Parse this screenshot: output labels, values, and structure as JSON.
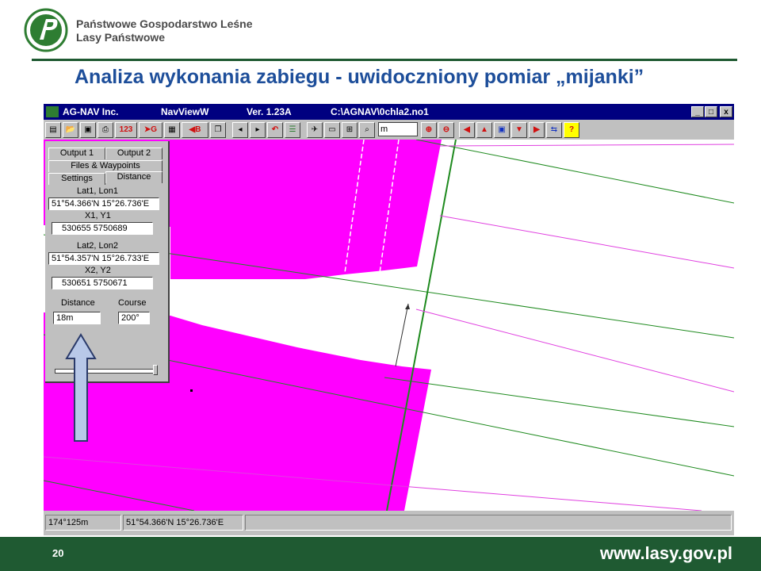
{
  "header": {
    "org_line1": "Państwowe Gospodarstwo Leśne",
    "org_line2": "Lasy Państwowe",
    "slide_title": "Analiza wykonania zabiegu - uwidoczniony pomiar „mijanki”"
  },
  "window": {
    "vendor": "AG-NAV Inc.",
    "app": "NavViewW",
    "version": "Ver. 1.23A",
    "file_path": "C:\\AGNAV\\0chla2.no1",
    "title_bar_color": "#000080",
    "buttons": {
      "minimize": "_",
      "maximize": "□",
      "close": "x"
    }
  },
  "toolbar": {
    "units_value": "m",
    "gps_label": "123",
    "g_label": "G",
    "b_label": "B",
    "help_label": "?",
    "icons": [
      "print-icon",
      "open-icon",
      "save-icon",
      "printer-icon",
      "gps-icon",
      "go-icon",
      "grid-icon",
      "back-icon",
      "copy-icon",
      "prev-icon",
      "next-icon",
      "undo-icon",
      "list-icon",
      "plane-icon",
      "map-icon",
      "zoom-box-icon",
      "zoom-in-icon",
      "zoom-out-icon",
      "arrow-left-icon",
      "arrow-up-icon",
      "center-icon",
      "arrow-down-icon",
      "arrow-right-icon",
      "swap-icon",
      "help-icon"
    ]
  },
  "panel": {
    "tabs": {
      "output1": "Output 1",
      "output2": "Output 2",
      "files": "Files & Waypoints",
      "settings": "Settings",
      "distance": "Distance"
    },
    "lat1_label": "Lat1, Lon1",
    "lat1_value": "51°54.366'N 15°26.736'E",
    "xy1_label": "X1, Y1",
    "xy1_value": "530655   5750689",
    "lat2_label": "Lat2, Lon2",
    "lat2_value": "51°54.357'N 15°26.733'E",
    "xy2_label": "X2, Y2",
    "xy2_value": "530651   5750671",
    "distance_label": "Distance",
    "distance_value": "18m",
    "course_label": "Course",
    "course_value": "200°"
  },
  "status": {
    "position": "174°125m",
    "coordinates": "51°54.366'N 15°26.736'E",
    "empty": ""
  },
  "footer": {
    "page_number": "20",
    "url": "www.lasy.gov.pl"
  },
  "colors": {
    "spray_area": "#ff00ff",
    "guide_line_green": "#1e8a1e",
    "guide_line_magenta": "#e040e0",
    "footer_bg": "#1f5a32",
    "title": "#1d4e9a",
    "arrow": "#b8c8e8"
  }
}
